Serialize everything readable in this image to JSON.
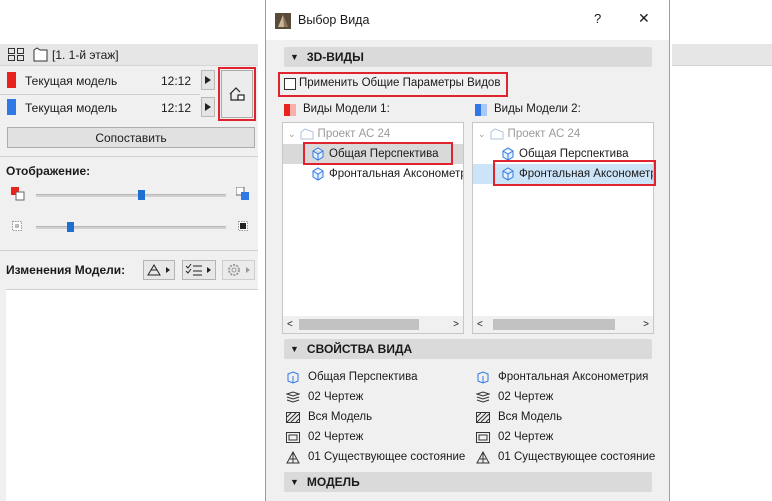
{
  "left_panel": {
    "floor_label": "[1. 1-й этаж]",
    "models": [
      {
        "name": "Текущая модель",
        "time": "12:12",
        "color": "#e8231d"
      },
      {
        "name": "Текущая модель",
        "time": "12:12",
        "color": "#2f78e6"
      }
    ],
    "compare_button": "Сопоставить",
    "display_label": "Отображение:",
    "sliders": [
      0.55,
      0.18
    ],
    "changes_label": "Изменения Модели:"
  },
  "dialog": {
    "title": "Выбор Вида",
    "help_button": "?",
    "close_button": "✕",
    "section_3d": "3D-ВИДЫ",
    "apply_checkbox_label": "Применить Общие Параметры Видов",
    "apply_checked": false,
    "model1_header": "Виды Модели 1:",
    "model2_header": "Виды Модели 2:",
    "tree1": {
      "project": "Проект АС 24",
      "items": [
        "Общая Перспектива",
        "Фронтальная Аксонометрия"
      ],
      "selected_index": 0
    },
    "tree2": {
      "project": "Проект АС 24",
      "items": [
        "Общая Перспектива",
        "Фронтальная Аксонометрия"
      ],
      "selected_index": 1
    },
    "section_props": "СВОЙСТВА ВИДА",
    "props_left": [
      "Общая Перспектива",
      "02 Чертеж",
      "Вся Модель",
      "02 Чертеж",
      "01 Существующее состояние"
    ],
    "props_right": [
      "Фронтальная Аксонометрия",
      "02 Чертеж",
      "Вся Модель",
      "02 Чертеж",
      "01 Существующее состояние"
    ],
    "section_model": "МОДЕЛЬ"
  },
  "colors": {
    "highlight": "#e0232e",
    "selection": "#cce4f7",
    "accent": "#1f6fd1"
  }
}
